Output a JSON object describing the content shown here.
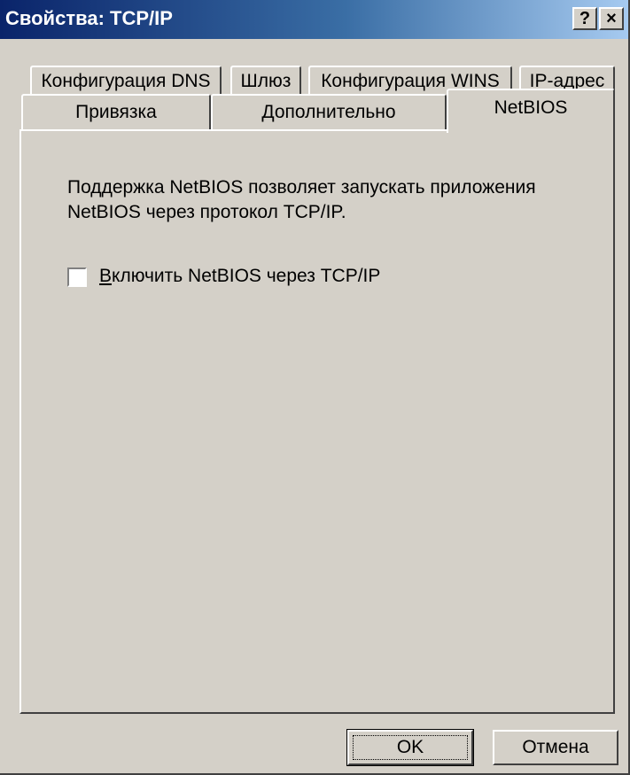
{
  "window": {
    "title": "Свойства: TCP/IP",
    "help_button": "?",
    "close_button": "×"
  },
  "tabs": {
    "row1": [
      {
        "label": "Конфигурация DNS"
      },
      {
        "label": "Шлюз"
      },
      {
        "label": "Конфигурация WINS"
      },
      {
        "label": "IP-адрес"
      }
    ],
    "row2": [
      {
        "label": "Привязка"
      },
      {
        "label": "Дополнительно"
      },
      {
        "label": "NetBIOS",
        "active": true
      }
    ]
  },
  "panel": {
    "description": "Поддержка NetBIOS позволяет запускать приложения NetBIOS через протокол TCP/IP.",
    "checkbox": {
      "label_mnemonic": "В",
      "label_rest": "ключить NetBIOS через TCP/IP",
      "checked": false
    }
  },
  "buttons": {
    "ok": "OK",
    "cancel": "Отмена"
  }
}
